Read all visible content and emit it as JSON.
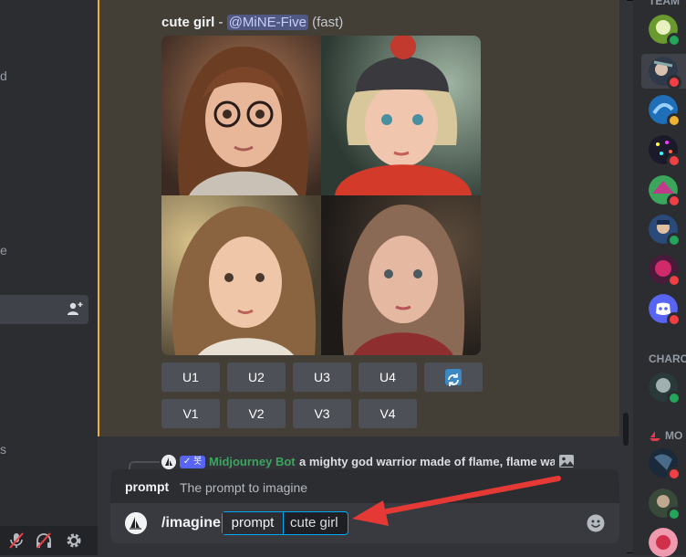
{
  "message": {
    "prompt_text": "cute girl",
    "separator": " - ",
    "mention": "@MiNE-Five",
    "mode": "(fast)"
  },
  "buttons": {
    "upscale": [
      "U1",
      "U2",
      "U3",
      "U4"
    ],
    "variation": [
      "V1",
      "V2",
      "V3",
      "V4"
    ],
    "refresh_icon": "refresh-icon"
  },
  "reply_preview": {
    "bot_badge": "✓ 봇",
    "author": "Midjourney Bot",
    "text": "a mighty god warrior made of flame, flame wa",
    "author_color": "#3ba55c"
  },
  "autocomplete": {
    "option_name": "prompt",
    "option_desc": "The prompt to imagine"
  },
  "input": {
    "command": "/imagine",
    "option_name": "prompt",
    "option_value": "cute girl"
  },
  "left_sidebar_fragments": [
    "d",
    "e",
    "s"
  ],
  "member_list": {
    "categories": [
      "TEAM",
      "CHARC",
      "MO"
    ],
    "status_colors": {
      "online": "#23a55a",
      "dnd": "#f23f43",
      "idle": "#f0b232"
    }
  },
  "colors": {
    "highlight_border": "#f0b132",
    "mention_bg": "#505884",
    "accent_blue": "#00a8fc",
    "arrow_red": "#e53935"
  }
}
